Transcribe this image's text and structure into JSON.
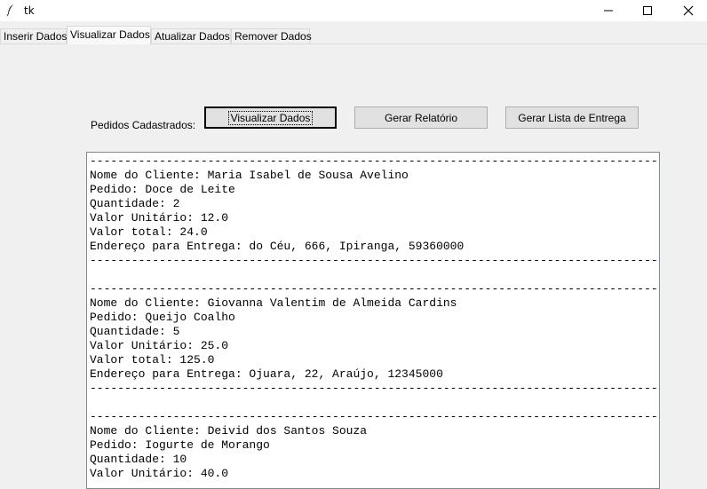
{
  "window": {
    "title": "tk",
    "minimize": "—",
    "maximize": "☐",
    "close": "✕",
    "icon": "feather-icon"
  },
  "tabs": [
    {
      "label": "Inserir Dados"
    },
    {
      "label": "Visualizar Dados"
    },
    {
      "label": "Atualizar Dados"
    },
    {
      "label": "Remover Dados"
    }
  ],
  "active_tab": "Visualizar Dados",
  "main": {
    "label": "Pedidos Cadastrados:",
    "buttons": {
      "view": "Visualizar Dados",
      "report": "Gerar Relatório",
      "delivery": "Gerar Lista de Entrega"
    },
    "text_content": "----------------------------------------------------------------------------------\nNome do Cliente: Maria Isabel de Sousa Avelino\nPedido: Doce de Leite\nQuantidade: 2\nValor Unitário: 12.0\nValor total: 24.0\nEndereço para Entrega: do Céu, 666, Ipiranga, 59360000\n----------------------------------------------------------------------------------\n\n----------------------------------------------------------------------------------\nNome do Cliente: Giovanna Valentim de Almeida Cardins\nPedido: Queijo Coalho\nQuantidade: 5\nValor Unitário: 25.0\nValor total: 125.0\nEndereço para Entrega: Ojuara, 22, Araújo, 12345000\n----------------------------------------------------------------------------------\n\n----------------------------------------------------------------------------------\nNome do Cliente: Deivid dos Santos Souza\nPedido: Iogurte de Morango\nQuantidade: 10\nValor Unitário: 40.0"
  }
}
